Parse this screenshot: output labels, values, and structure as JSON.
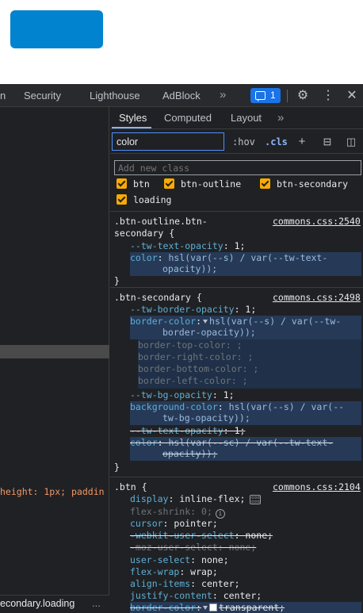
{
  "devtools_tabs": [
    {
      "label": "n"
    },
    {
      "label": "Security"
    },
    {
      "label": "Lighthouse"
    },
    {
      "label": "AdBlock"
    }
  ],
  "more_tabs_glyph": "»",
  "issues_count": "1",
  "icons": {
    "settings": "gear-icon",
    "kebab": "kebab-menu-icon",
    "close": "close-icon"
  },
  "left_pane": {
    "code_snippet": "height: 1px; paddin",
    "breadcrumb": "econdary.loading",
    "breadcrumb_more": "..."
  },
  "styles_pane": {
    "subtabs": [
      "Styles",
      "Computed",
      "Layout"
    ],
    "subtabs_more": "»",
    "filter_value": "color",
    "hov_label": ":hov",
    "cls_label": ".cls",
    "add_class_placeholder": "Add new class",
    "classes": [
      {
        "name": "btn",
        "checked": true
      },
      {
        "name": "btn-outline",
        "checked": true
      },
      {
        "name": "btn-secondary",
        "checked": true
      },
      {
        "name": "loading",
        "checked": true
      }
    ],
    "rules": [
      {
        "selector_line1": ".btn-outline.btn-",
        "selector_line2": "secondary {",
        "source": "commons.css:2540",
        "decls": [
          {
            "prop": "--tw-text-opacity",
            "val": "1;"
          },
          {
            "prop": "color",
            "val_line1": "hsl(var(--s) / var(--tw-text-",
            "val_line2": "opacity));"
          }
        ],
        "close": "}"
      },
      {
        "selector": ".btn-secondary {",
        "source": "commons.css:2498",
        "decls": [
          {
            "prop": "--tw-border-opacity",
            "val": "1;"
          },
          {
            "prop": "border-color",
            "val_line1": "hsl(var(--s) / var(--tw-",
            "val_line2": "border-opacity));"
          },
          {
            "prop": "border-top-color",
            "val": ";"
          },
          {
            "prop": "border-right-color",
            "val": ";"
          },
          {
            "prop": "border-bottom-color",
            "val": ";"
          },
          {
            "prop": "border-left-color",
            "val": ";"
          },
          {
            "prop": "--tw-bg-opacity",
            "val": "1;"
          },
          {
            "prop": "background-color",
            "val_line1": "hsl(var(--s) / var(--",
            "val_line2": "tw-bg-opacity));"
          },
          {
            "prop": "--tw-text-opacity",
            "val": "1;"
          },
          {
            "prop": "color",
            "val_line1": "hsl(var(--sc) / var(--tw-text-",
            "val_line2": "opacity));"
          }
        ],
        "close": "}"
      },
      {
        "selector": ".btn {",
        "source": "commons.css:2104",
        "decls": [
          {
            "prop": "display",
            "val": "inline-flex;"
          },
          {
            "prop": "flex-shrink",
            "val": "0;"
          },
          {
            "prop": "cursor",
            "val": "pointer;"
          },
          {
            "prop": "-webkit-user-select",
            "val": "none;"
          },
          {
            "prop": "-moz-user-select",
            "val": "none;"
          },
          {
            "prop": "user-select",
            "val": "none;"
          },
          {
            "prop": "flex-wrap",
            "val": "wrap;"
          },
          {
            "prop": "align-items",
            "val": "center;"
          },
          {
            "prop": "justify-content",
            "val": "center;"
          },
          {
            "prop": "border-color",
            "val": "transparent;"
          }
        ]
      }
    ]
  },
  "colors": {
    "page_button": "#0183d0",
    "panel_bg": "#202124",
    "accent": "#8ab4f8",
    "checkbox": "#f9ab00",
    "property": "#5db0d7"
  }
}
